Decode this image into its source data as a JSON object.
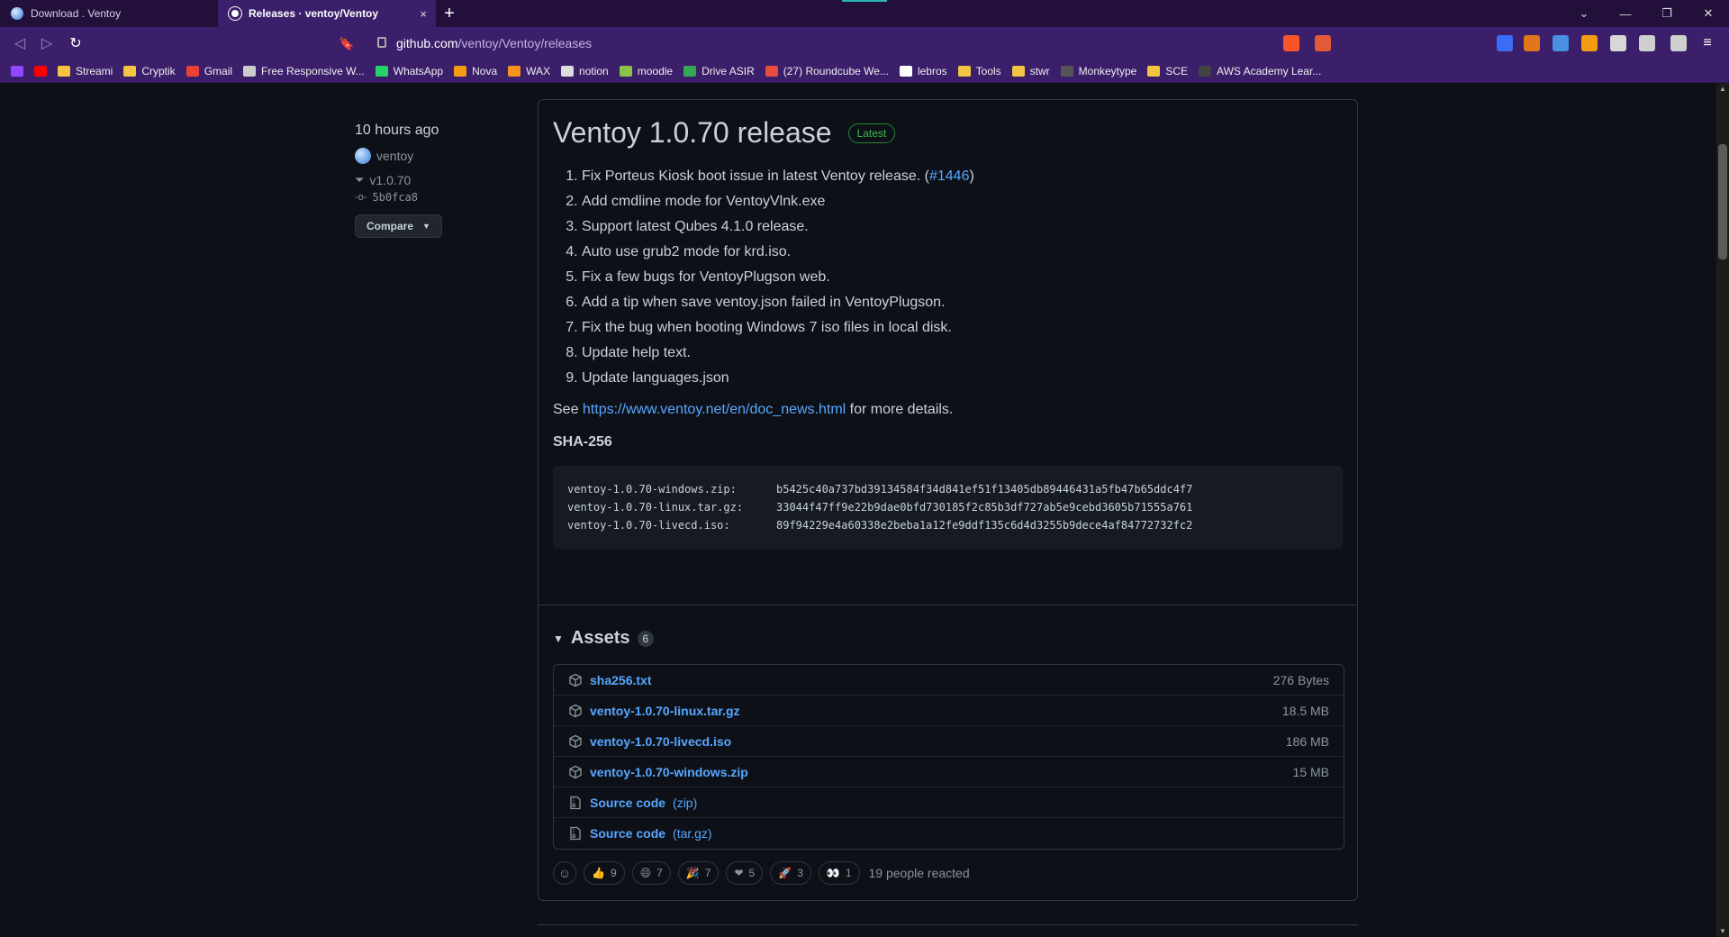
{
  "tabs": [
    {
      "title": "Download . Ventoy"
    },
    {
      "title": "Releases · ventoy/Ventoy",
      "close": "×"
    }
  ],
  "new_tab": "+",
  "window_controls": {
    "minimize": "—",
    "restore": "❐",
    "close": "✕",
    "dropdown": "⌄"
  },
  "address": {
    "host": "github.com",
    "path": "/ventoy/Ventoy/releases"
  },
  "bookmarks": [
    {
      "label": "",
      "color": "#9146ff"
    },
    {
      "label": "",
      "color": "#ff0000"
    },
    {
      "label": "Streami",
      "color": "#f4c542"
    },
    {
      "label": "Cryptik",
      "color": "#f4c542"
    },
    {
      "label": "Gmail",
      "color": "#ea4335"
    },
    {
      "label": "Free Responsive W...",
      "color": "#cccccc"
    },
    {
      "label": "WhatsApp",
      "color": "#25d366"
    },
    {
      "label": "Nova",
      "color": "#f39c12"
    },
    {
      "label": "WAX",
      "color": "#f7931a"
    },
    {
      "label": "notion",
      "color": "#dddddd"
    },
    {
      "label": "moodle",
      "color": "#8bc34a"
    },
    {
      "label": "Drive ASIR",
      "color": "#34a853"
    },
    {
      "label": "(27) Roundcube We...",
      "color": "#e74c3c"
    },
    {
      "label": "lebros",
      "color": "#ffffff"
    },
    {
      "label": "Tools",
      "color": "#f4c542"
    },
    {
      "label": "stwr",
      "color": "#f4c542"
    },
    {
      "label": "Monkeytype",
      "color": "#555555"
    },
    {
      "label": "SCE",
      "color": "#f4c542"
    },
    {
      "label": "AWS Academy Lear...",
      "color": "#444444"
    }
  ],
  "sidebar": {
    "time": "10 hours ago",
    "author": "ventoy",
    "tag": "v1.0.70",
    "commit": "5b0fca8",
    "compare_label": "Compare"
  },
  "release": {
    "title": "Ventoy 1.0.70 release",
    "badge": "Latest",
    "notes": [
      {
        "text": "Fix Porteus Kiosk boot issue in latest Ventoy release. (",
        "link": "#1446",
        "after": ")"
      },
      {
        "text": "Add cmdline mode for VentoyVlnk.exe"
      },
      {
        "text": "Support latest Qubes 4.1.0 release."
      },
      {
        "text": "Auto use grub2 mode for krd.iso."
      },
      {
        "text": "Fix a few bugs for VentoyPlugson web."
      },
      {
        "text": "Add a tip when save ventoy.json failed in VentoyPlugson."
      },
      {
        "text": "Fix the bug when booting Windows 7 iso files in local disk."
      },
      {
        "text": "Update help text."
      },
      {
        "text": "Update languages.json"
      }
    ],
    "see_prefix": "See ",
    "see_link": "https://www.ventoy.net/en/doc_news.html",
    "see_suffix": " for more details.",
    "sha_title": "SHA-256",
    "checksums": [
      {
        "file": "ventoy-1.0.70-windows.zip:",
        "hash": "b5425c40a737bd39134584f34d841ef51f13405db89446431a5fb47b65ddc4f7"
      },
      {
        "file": "ventoy-1.0.70-linux.tar.gz:",
        "hash": "33044f47ff9e22b9dae0bfd730185f2c85b3df727ab5e9cebd3605b71555a761"
      },
      {
        "file": "ventoy-1.0.70-livecd.iso:",
        "hash": "89f94229e4a60338e2beba1a12fe9ddf135c6d4d3255b9dece4af84772732fc2"
      }
    ]
  },
  "assets": {
    "title": "Assets",
    "count": "6",
    "items": [
      {
        "name": "sha256.txt",
        "suffix": "",
        "size": "276 Bytes",
        "icon": "package-icon"
      },
      {
        "name": "ventoy-1.0.70-linux.tar.gz",
        "suffix": "",
        "size": "18.5 MB",
        "icon": "package-icon"
      },
      {
        "name": "ventoy-1.0.70-livecd.iso",
        "suffix": "",
        "size": "186 MB",
        "icon": "package-icon"
      },
      {
        "name": "ventoy-1.0.70-windows.zip",
        "suffix": "",
        "size": "15 MB",
        "icon": "package-icon"
      },
      {
        "name": "Source code",
        "suffix": "(zip)",
        "size": "",
        "icon": "file-zip-icon"
      },
      {
        "name": "Source code",
        "suffix": "(tar.gz)",
        "size": "",
        "icon": "file-zip-icon"
      }
    ]
  },
  "reactions": {
    "items": [
      {
        "emoji": "👍",
        "count": "9"
      },
      {
        "emoji": "😄",
        "count": "7"
      },
      {
        "emoji": "🎉",
        "count": "7"
      },
      {
        "emoji": "❤",
        "count": "5"
      },
      {
        "emoji": "🚀",
        "count": "3"
      },
      {
        "emoji": "👀",
        "count": "1"
      }
    ],
    "summary": "19 people reacted"
  },
  "colors": {
    "accent_link": "#58a6ff",
    "latest_green": "#3fb950",
    "browser_purple": "#3b1f6a"
  }
}
